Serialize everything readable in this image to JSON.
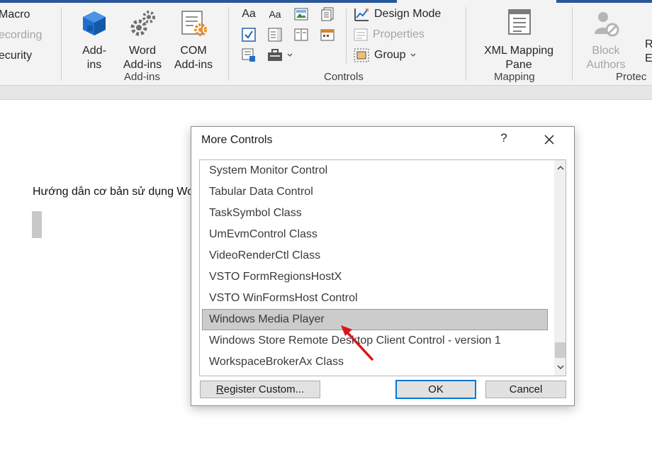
{
  "ribbon": {
    "code_group": {
      "macro": "Macro",
      "recording": "ecording",
      "security": "ecurity"
    },
    "addins_group": {
      "addins_label": "Add-\nins",
      "word_addins_label": "Word\nAdd-ins",
      "com_addins_label": "COM\nAdd-ins",
      "group_label": "Add-ins"
    },
    "controls_group": {
      "rich_text_glyph": "Aa",
      "plain_text_glyph": "Aa",
      "design_mode": "Design Mode",
      "properties": "Properties",
      "group": "Group",
      "group_label": "Controls"
    },
    "mapping_group": {
      "xml_mapping_pane": "XML Mapping\nPane",
      "group_label": "Mapping"
    },
    "protect_group": {
      "block_authors": "Block\nAuthors",
      "restrict_partial_top": "R",
      "restrict_partial_bottom": "E",
      "group_label": "Protec"
    },
    "colors": {
      "accent": "#2b579a",
      "addins_blue": "#1e6fd0",
      "com_orange": "#f08c1d"
    }
  },
  "document": {
    "text": "Hướng dẫn cơ bản sử dụng Word"
  },
  "dialog": {
    "title": "More Controls",
    "help": "?",
    "items": [
      "System Monitor Control",
      "Tabular Data Control",
      "TaskSymbol Class",
      "UmEvmControl Class",
      "VideoRenderCtl Class",
      "VSTO FormRegionsHostX",
      "VSTO WinFormsHost Control",
      "Windows Media Player",
      "Windows Store Remote Desktop Client Control - version 1",
      "WorkspaceBrokerAx Class"
    ],
    "selected_item": "Windows Media Player",
    "register_button": {
      "underlined": "R",
      "rest": "egister Custom..."
    },
    "ok_button": "OK",
    "cancel_button": "Cancel",
    "annotation_color": "#d9141c"
  }
}
